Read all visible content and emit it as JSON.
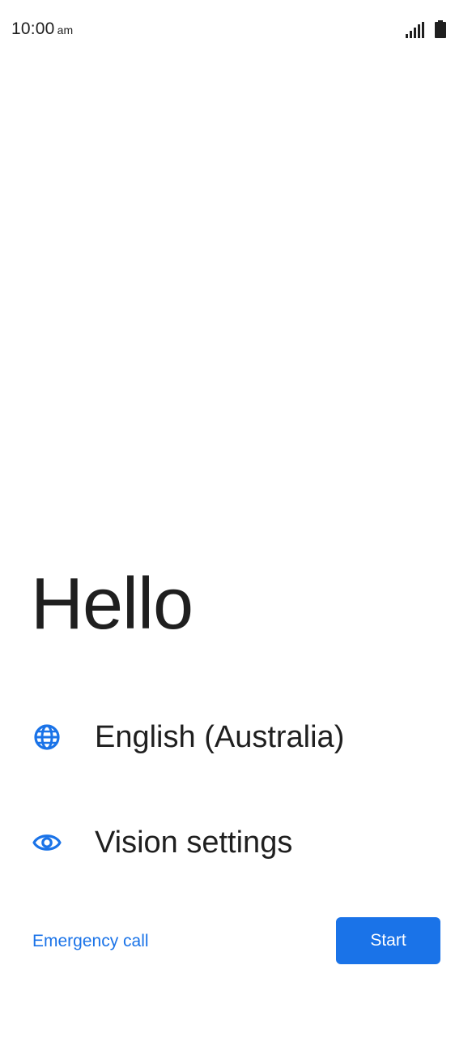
{
  "status_bar": {
    "time": "10:00",
    "ampm": "am",
    "signal_icon": "cellular-signal-icon",
    "battery_icon": "battery-full-icon"
  },
  "welcome": {
    "title": "Hello"
  },
  "options": [
    {
      "label": "English (Australia)",
      "icon": "globe-icon"
    },
    {
      "label": "Vision settings",
      "icon": "eye-icon"
    }
  ],
  "actions": {
    "emergency_call": "Emergency call",
    "start": "Start"
  },
  "colors": {
    "accent": "#1a73e8",
    "text": "#1f1f1f",
    "background": "#ffffff"
  }
}
